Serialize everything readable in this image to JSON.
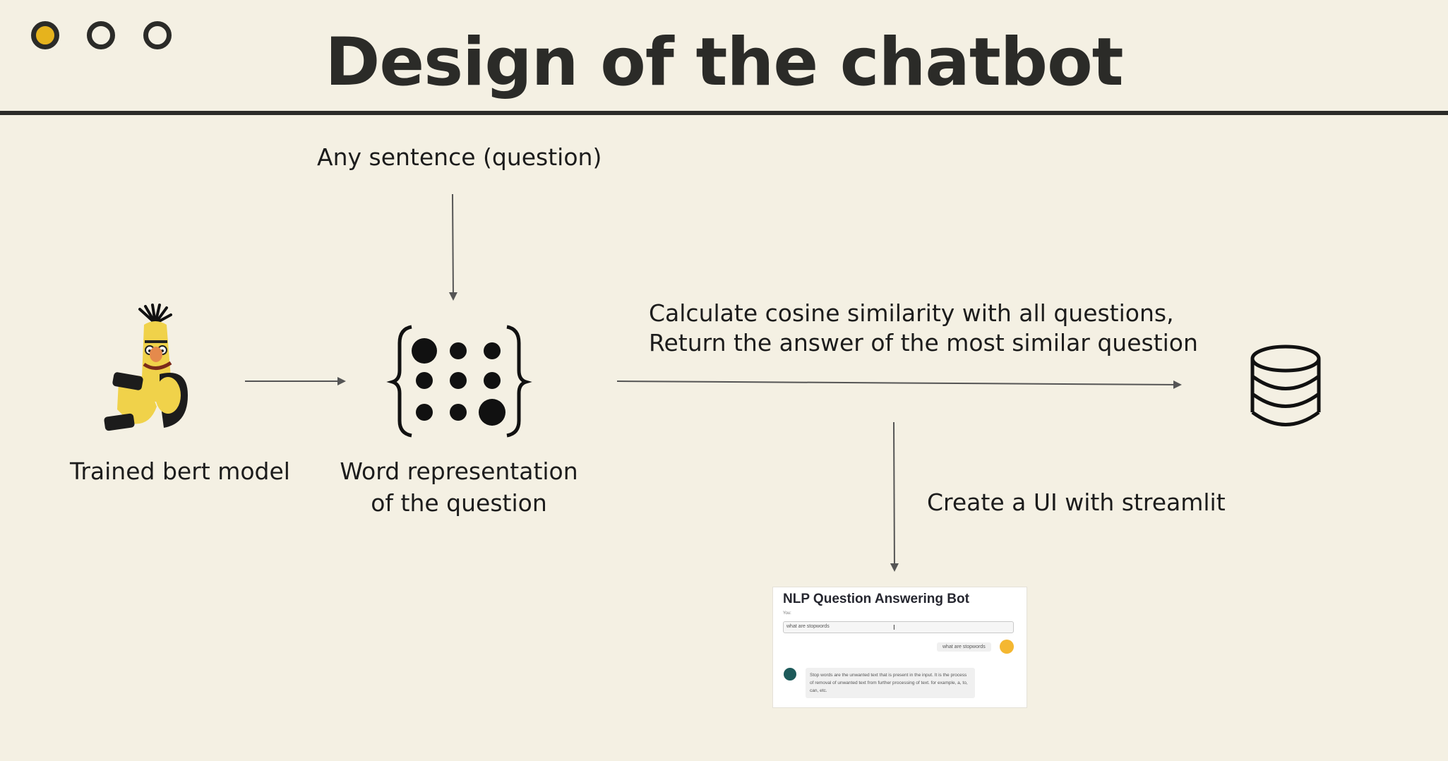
{
  "window_controls": [
    "close-dot",
    "minimize-dot",
    "maximize-dot"
  ],
  "title": "Design of the chatbot",
  "nodes": {
    "input_label": "Any sentence (question)",
    "model_label": "Trained bert model",
    "word_rep_label_line1": "Word representation",
    "word_rep_label_line2": "of the question",
    "similarity_line1": "Calculate cosine similarity with all questions,",
    "similarity_line2": "Return the answer of the most similar question",
    "ui_label": "Create a UI with streamlit"
  },
  "icons": {
    "model": "bert-character-icon",
    "word_rep": "vector-matrix-icon",
    "database": "database-icon"
  },
  "app_preview": {
    "title": "NLP Question Answering Bot",
    "input_label": "You:",
    "input_value": "what are stopwords",
    "cursor": "I",
    "user_message": "what are stopwords",
    "bot_answer": "Stop words are the unwanted text that is present in the input. It is the process of removal of unwanted text from further processing of text. for example, a, to, can, etc."
  },
  "colors": {
    "background": "#f4f0e3",
    "ink": "#2b2b28",
    "accent": "#e6b31d",
    "arrow": "#555555"
  }
}
